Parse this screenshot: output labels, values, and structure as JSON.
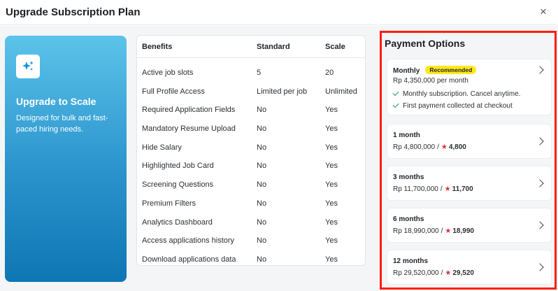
{
  "modal": {
    "title": "Upgrade Subscription Plan",
    "close_icon": "×"
  },
  "hero": {
    "icon": "sparkles-icon",
    "title": "Upgrade to Scale",
    "description": "Designed for bulk and fast-paced hiring needs."
  },
  "benefits": {
    "headers": [
      "Benefits",
      "Standard",
      "Scale"
    ],
    "rows": [
      [
        "Active job slots",
        "5",
        "20"
      ],
      [
        "Full Profile Access",
        "Limited per job",
        "Unlimited"
      ],
      [
        "Required Application Fields",
        "No",
        "Yes"
      ],
      [
        "Mandatory Resume Upload",
        "No",
        "Yes"
      ],
      [
        "Hide Salary",
        "No",
        "Yes"
      ],
      [
        "Highlighted Job Card",
        "No",
        "Yes"
      ],
      [
        "Screening Questions",
        "No",
        "Yes"
      ],
      [
        "Premium Filters",
        "No",
        "Yes"
      ],
      [
        "Analytics Dashboard",
        "No",
        "Yes"
      ],
      [
        "Access applications history",
        "No",
        "Yes"
      ],
      [
        "Download applications data",
        "No",
        "Yes"
      ]
    ]
  },
  "payment": {
    "title": "Payment Options",
    "options": [
      {
        "title": "Monthly",
        "badge": "Recommended",
        "price": "Rp 4,350,000 per month",
        "features": [
          "Monthly subscription. Cancel anytime.",
          "First payment collected at checkout"
        ]
      },
      {
        "title": "1 month",
        "price": "Rp 4,800,000",
        "slash": "/",
        "points": "4,800"
      },
      {
        "title": "3 months",
        "price": "Rp 11,700,000",
        "slash": "/",
        "points": "11,700"
      },
      {
        "title": "6 months",
        "price": "Rp 18,990,000",
        "slash": "/",
        "points": "18,990"
      },
      {
        "title": "12 months",
        "price": "Rp 29,520,000",
        "slash": "/",
        "points": "29,520"
      }
    ],
    "star_glyph": "★"
  },
  "colors": {
    "accent_gradient_top": "#5cc3ea",
    "accent_gradient_bottom": "#0f76b4",
    "highlight_border": "#ff1e10",
    "badge": "#ffe81c",
    "check": "#1e9d55",
    "star": "#e0303a"
  }
}
